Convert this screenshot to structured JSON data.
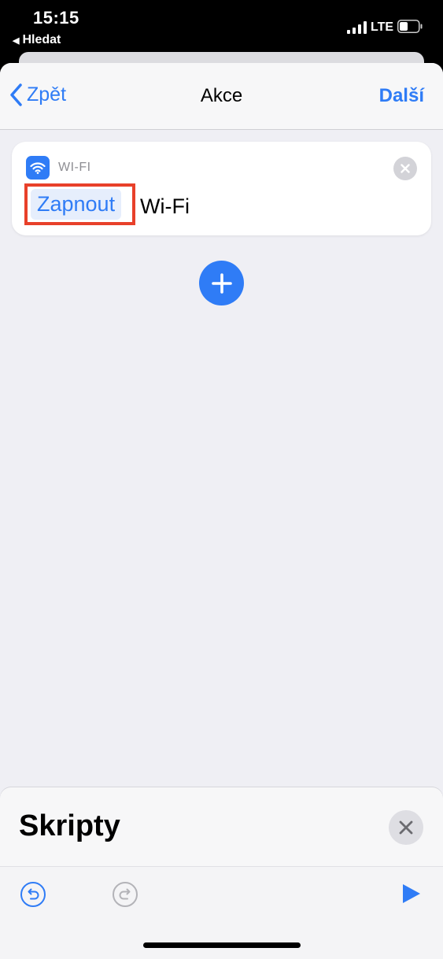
{
  "status_bar": {
    "time": "15:15",
    "back_app": "Hledat",
    "network": "LTE"
  },
  "navbar": {
    "back_label": "Zpět",
    "title": "Akce",
    "next_label": "Další"
  },
  "action_card": {
    "category": "WI-FI",
    "parameter": "Zapnout",
    "text": "Wi-Fi",
    "icon": "wifi-icon"
  },
  "bottom_panel": {
    "title": "Skripty"
  },
  "colors": {
    "accent": "#2f7cf6",
    "highlight": "#e8402a",
    "background": "#efeff4"
  }
}
